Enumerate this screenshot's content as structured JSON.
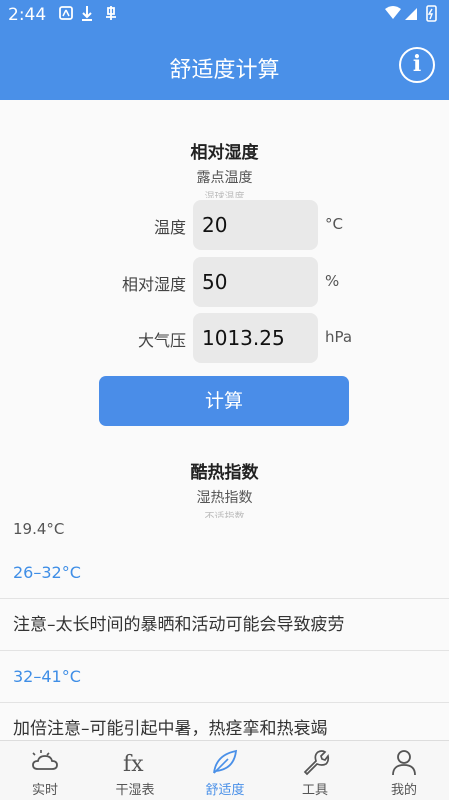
{
  "status": {
    "time": "2:44"
  },
  "appbar": {
    "title": "舒适度计算",
    "info_icon": "info-icon"
  },
  "picker_mode": {
    "selected": "相对湿度",
    "next": "露点温度",
    "next2": "湿球温度"
  },
  "inputs": [
    {
      "label": "温度",
      "value": "20",
      "unit": "°C"
    },
    {
      "label": "相对湿度",
      "value": "50",
      "unit": "%"
    },
    {
      "label": "大气压",
      "value": "1013.25",
      "unit": "hPa"
    }
  ],
  "calc_button": "计算",
  "picker_index": {
    "selected": "酷热指数",
    "next": "湿热指数",
    "next2": "不适指数"
  },
  "result": {
    "value": "19.4°C"
  },
  "levels": [
    {
      "text": "26–32°C",
      "kind": "range"
    },
    {
      "text": "注意–太长时间的暴晒和活动可能会导致疲劳",
      "kind": "note"
    },
    {
      "text": "32–41°C",
      "kind": "range"
    },
    {
      "text": "加倍注意–可能引起中暑，热痉挛和热衰竭",
      "kind": "note"
    }
  ],
  "nav": [
    {
      "label": "实时",
      "icon": "weather-icon",
      "active": false
    },
    {
      "label": "干湿表",
      "icon": "fx-icon",
      "active": false
    },
    {
      "label": "舒适度",
      "icon": "leaf-icon",
      "active": true
    },
    {
      "label": "工具",
      "icon": "wrench-icon",
      "active": false
    },
    {
      "label": "我的",
      "icon": "person-icon",
      "active": false
    }
  ],
  "colors": {
    "primary": "#4a90e8",
    "link": "#3f8ee6"
  }
}
